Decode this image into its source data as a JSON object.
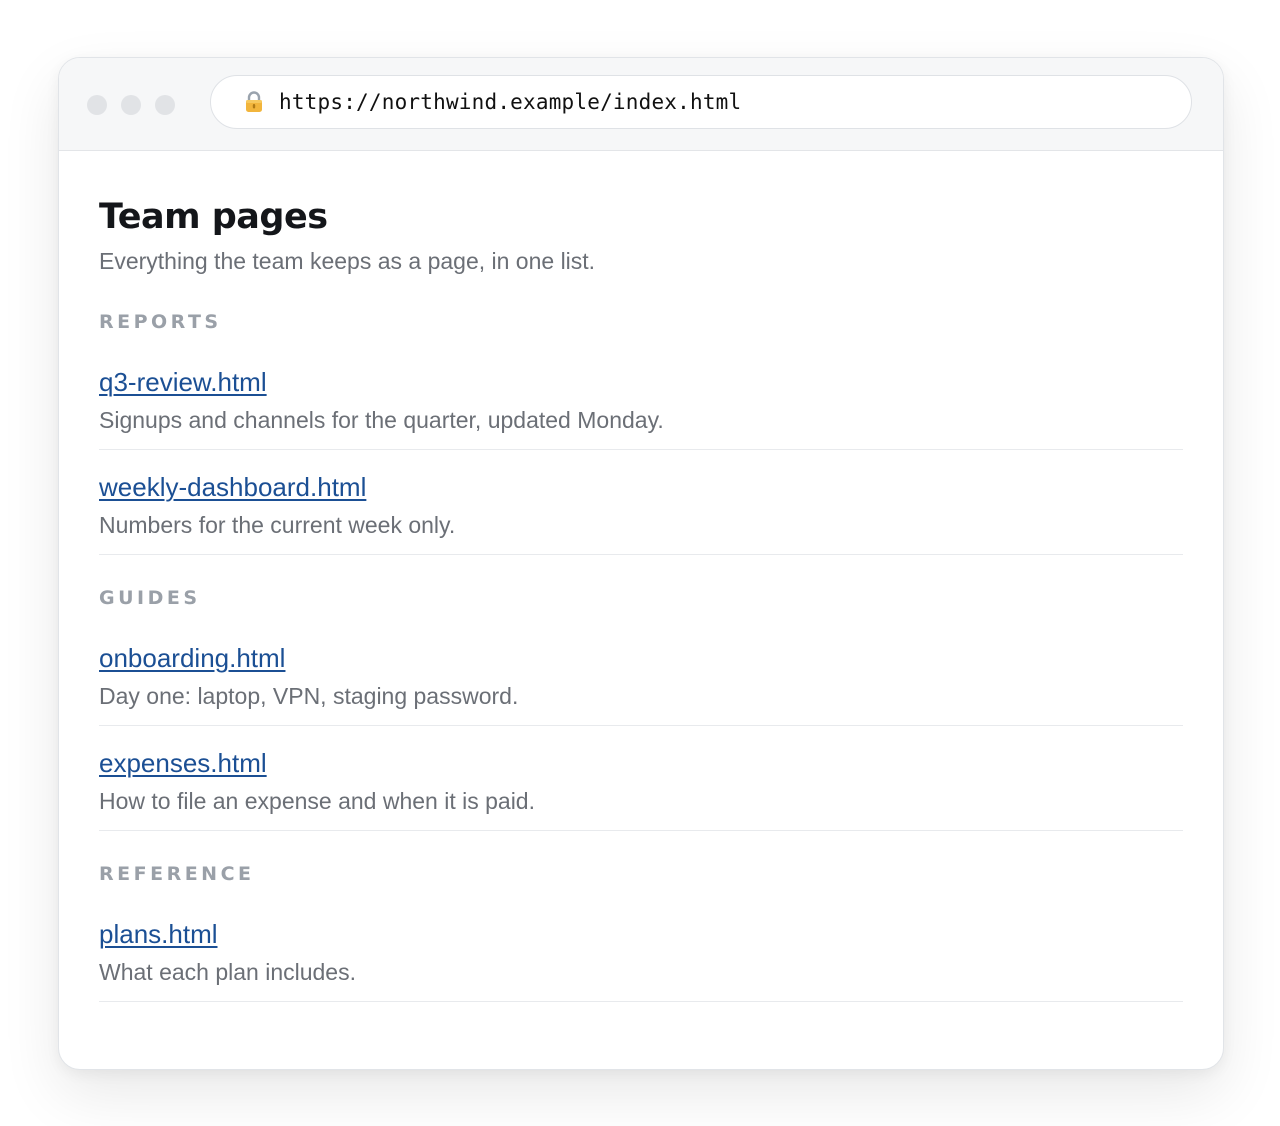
{
  "browser": {
    "url": "https://northwind.example/index.html",
    "lock_icon": "lock-icon"
  },
  "page": {
    "title": "Team pages",
    "subtitle": "Everything the team keeps as a page, in one list."
  },
  "sections": [
    {
      "heading": "REPORTS",
      "items": [
        {
          "link": "q3-review.html",
          "desc": "Signups and channels for the quarter, updated Monday."
        },
        {
          "link": "weekly-dashboard.html",
          "desc": "Numbers for the current week only."
        }
      ]
    },
    {
      "heading": "GUIDES",
      "items": [
        {
          "link": "onboarding.html",
          "desc": "Day one: laptop, VPN, staging password."
        },
        {
          "link": "expenses.html",
          "desc": "How to file an expense and when it is paid."
        }
      ]
    },
    {
      "heading": "REFERENCE",
      "items": [
        {
          "link": "plans.html",
          "desc": "What each plan includes."
        }
      ]
    }
  ]
}
